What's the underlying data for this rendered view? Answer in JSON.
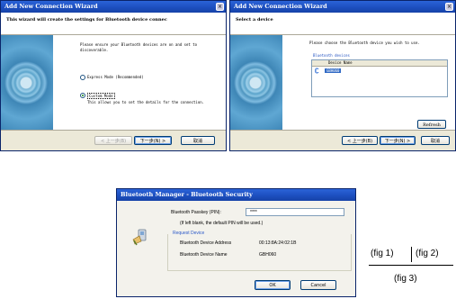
{
  "fig1": {
    "title": "Add New Connection Wizard",
    "header": "This wizard will create the settings for Bluetooth device connec",
    "intro": "Please ensure your Bluetooth devices are on and set to discoverable.",
    "option_express": "Express Mode (Recommended)",
    "option_custom": "Custom Mode",
    "custom_desc": "This allows you to set the details for the connection.",
    "btn_back": "< 上一步(B)",
    "btn_next": "下一步(N) >",
    "btn_cancel": "取消"
  },
  "fig2": {
    "title": "Add New Connection Wizard",
    "header": "Select a device",
    "intro": "Please choose the Bluetooth device you wish to use.",
    "group_label": "Bluetooth devices",
    "col_header": "Device Name",
    "device_name": "GBH060",
    "btn_refresh": "Refresh",
    "btn_back": "< 上一步(B)",
    "btn_next": "下一步(N) >",
    "btn_cancel": "取消"
  },
  "fig3": {
    "title": "Bluetooth Manager - Bluetooth Security",
    "passkey_label": "Bluetooth Passkey (PIN):",
    "passkey_value": "****",
    "hint": "(If left blank, the default PIN will be used.)",
    "group_label": "Request Device",
    "addr_label": "Bluetooth Device Address",
    "addr_value": "00:13:8A:24:02:1B",
    "name_label": "Bluetooth Device Name",
    "name_value": "GBH060",
    "btn_ok": "OK",
    "btn_cancel": "Cancel"
  },
  "caption": {
    "fig1": "(fig 1)",
    "fig2": "(fig 2)",
    "fig3": "(fig 3)"
  }
}
